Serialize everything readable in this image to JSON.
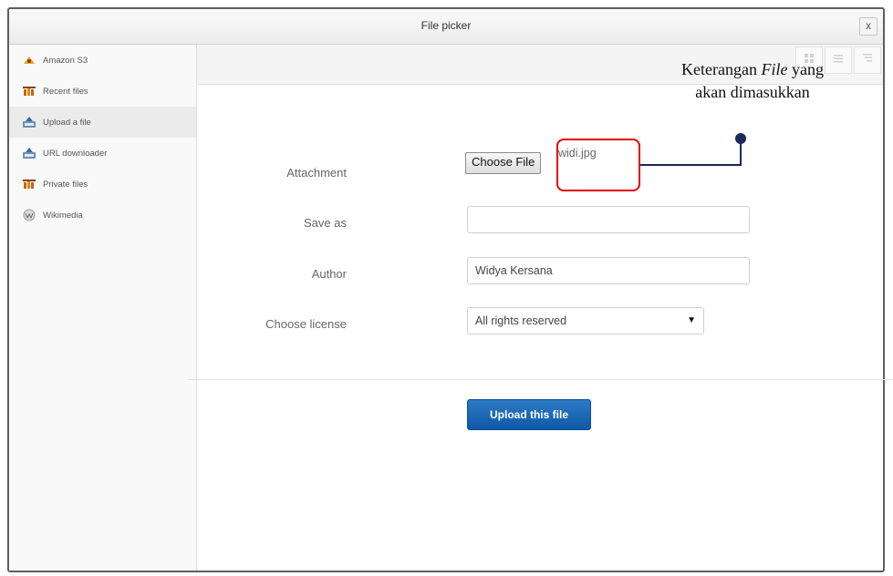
{
  "dialog": {
    "title": "File picker",
    "close_label": "x"
  },
  "sidebar": {
    "items": [
      {
        "label": "Amazon S3",
        "icon": "amazon-s3-icon",
        "active": false
      },
      {
        "label": "Recent files",
        "icon": "recent-files-icon",
        "active": false
      },
      {
        "label": "Upload a file",
        "icon": "upload-icon",
        "active": true
      },
      {
        "label": "URL downloader",
        "icon": "url-downloader-icon",
        "active": false
      },
      {
        "label": "Private files",
        "icon": "private-files-icon",
        "active": false
      },
      {
        "label": "Wikimedia",
        "icon": "wikimedia-icon",
        "active": false
      }
    ]
  },
  "form": {
    "attachment_label": "Attachment",
    "choose_file_label": "Choose File",
    "file_name": "widi.jpg",
    "save_as_label": "Save as",
    "save_as_value": "",
    "author_label": "Author",
    "author_value": "Widya Kersana",
    "license_label": "Choose license",
    "license_value": "All rights reserved",
    "upload_label": "Upload this file"
  },
  "annotation": {
    "line1_pre": "Keterangan ",
    "line1_em": "File",
    "line1_post": " yang",
    "line2": "akan dimasukkan"
  },
  "colors": {
    "highlight": "#e00000",
    "connector": "#1a2a5a",
    "primary_button": "#1560ad"
  }
}
